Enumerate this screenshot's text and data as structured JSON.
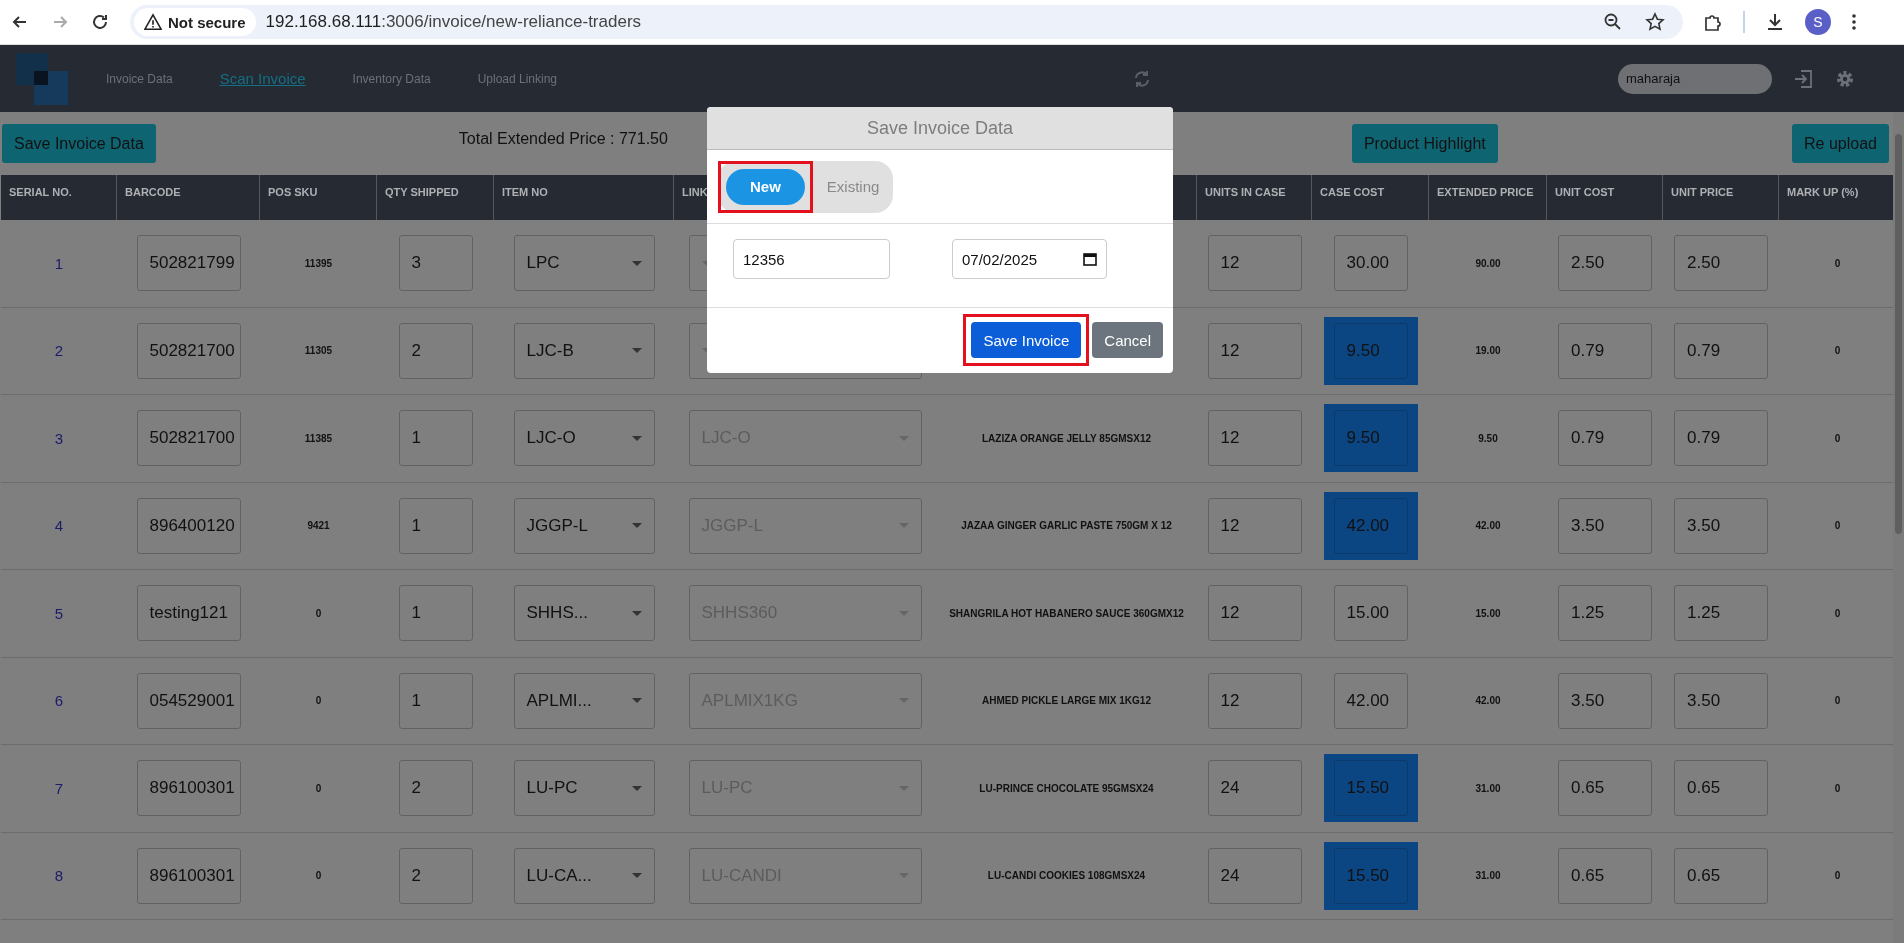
{
  "browser": {
    "security_label": "Not secure",
    "url_host": "192.168.68.111",
    "url_rest": ":3006/invoice/new-reliance-traders",
    "profile_initial": "S"
  },
  "nav": {
    "tabs": [
      {
        "label": "Invoice Data",
        "selected": false
      },
      {
        "label": "Scan Invoice",
        "selected": true
      },
      {
        "label": "Inventory Data",
        "selected": false
      },
      {
        "label": "Upload Linking",
        "selected": false
      }
    ],
    "user_field": "maharaja"
  },
  "toolbar": {
    "save_button": "Save Invoice Data",
    "total": "Total Extended Price : 771.50",
    "highlight_button": "Product Highlight",
    "reupload_button": "Re upload"
  },
  "table": {
    "columns": [
      "SERIAL NO.",
      "BARCODE",
      "POS SKU",
      "QTY SHIPPED",
      "ITEM NO",
      "LINK",
      "UNITS IN CASE",
      "CASE COST",
      "EXTENDED PRICE",
      "UNIT COST",
      "UNIT PRICE",
      "MARK UP (%)"
    ],
    "rows": [
      {
        "serial": "1",
        "barcode": "502821799",
        "pos_sku": "11395",
        "qty": "3",
        "item_no": "LPC",
        "units": "12",
        "case_cost": "30.00",
        "case_highlighted": false,
        "extended": "90.00",
        "unit_cost": "2.50",
        "unit_price": "2.50",
        "markup": "0"
      },
      {
        "serial": "2",
        "barcode": "502821700",
        "pos_sku": "11305",
        "qty": "2",
        "item_no": "LJC-B",
        "units": "12",
        "case_cost": "9.50",
        "case_highlighted": true,
        "extended": "19.00",
        "unit_cost": "0.79",
        "unit_price": "0.79",
        "markup": "0"
      },
      {
        "serial": "3",
        "barcode": "502821700",
        "pos_sku": "11385",
        "qty": "1",
        "item_no": "LJC-O",
        "link": "LJC-O",
        "description": "LAZIZA ORANGE JELLY 85GMSX12",
        "units": "12",
        "case_cost": "9.50",
        "case_highlighted": true,
        "extended": "9.50",
        "unit_cost": "0.79",
        "unit_price": "0.79",
        "markup": "0"
      },
      {
        "serial": "4",
        "barcode": "896400120",
        "pos_sku": "9421",
        "qty": "1",
        "item_no": "JGGP-L",
        "link": "JGGP-L",
        "description": "JAZAA GINGER GARLIC PASTE 750GM X 12",
        "units": "12",
        "case_cost": "42.00",
        "case_highlighted": true,
        "extended": "42.00",
        "unit_cost": "3.50",
        "unit_price": "3.50",
        "markup": "0"
      },
      {
        "serial": "5",
        "barcode": "testing121",
        "pos_sku": "0",
        "qty": "1",
        "item_no": "SHHS...",
        "link": "SHHS360",
        "description": "SHANGRILA HOT HABANERO SAUCE 360GMX12",
        "units": "12",
        "case_cost": "15.00",
        "case_highlighted": false,
        "extended": "15.00",
        "unit_cost": "1.25",
        "unit_price": "1.25",
        "markup": "0"
      },
      {
        "serial": "6",
        "barcode": "054529001",
        "pos_sku": "0",
        "qty": "1",
        "item_no": "APLMI...",
        "link": "APLMIX1KG",
        "description": "AHMED PICKLE LARGE MIX 1KG12",
        "units": "12",
        "case_cost": "42.00",
        "case_highlighted": false,
        "extended": "42.00",
        "unit_cost": "3.50",
        "unit_price": "3.50",
        "markup": "0"
      },
      {
        "serial": "7",
        "barcode": "896100301",
        "pos_sku": "0",
        "qty": "2",
        "item_no": "LU-PC",
        "link": "LU-PC",
        "description": "LU-PRINCE CHOCOLATE 95GMSX24",
        "units": "24",
        "case_cost": "15.50",
        "case_highlighted": true,
        "extended": "31.00",
        "unit_cost": "0.65",
        "unit_price": "0.65",
        "markup": "0"
      },
      {
        "serial": "8",
        "barcode": "896100301",
        "pos_sku": "0",
        "qty": "2",
        "item_no": "LU-CA...",
        "link": "LU-CANDI",
        "description": "LU-CANDI COOKIES 108GMSX24",
        "units": "24",
        "case_cost": "15.50",
        "case_highlighted": true,
        "extended": "31.00",
        "unit_cost": "0.65",
        "unit_price": "0.65",
        "markup": "0"
      }
    ]
  },
  "modal": {
    "title": "Save Invoice Data",
    "toggle": [
      {
        "label": "New",
        "selected": true,
        "highlighted": true
      },
      {
        "label": "Existing",
        "selected": false,
        "highlighted": false
      }
    ],
    "invoice_number": "12356",
    "date": "07/02/2025",
    "save_button": {
      "label": "Save Invoice",
      "highlighted": true
    },
    "cancel_button": "Cancel"
  }
}
